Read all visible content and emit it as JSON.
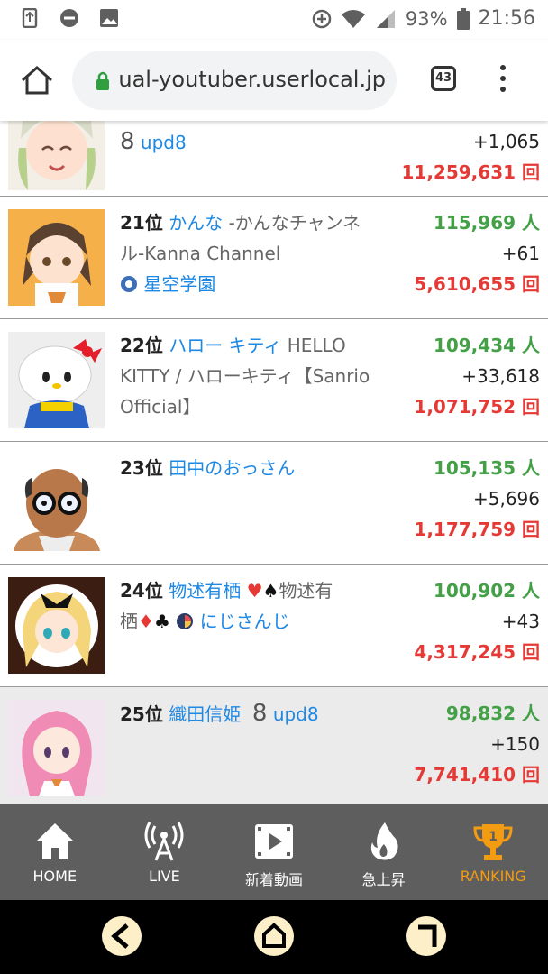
{
  "status": {
    "battery": "93%",
    "time": "21:56"
  },
  "browser": {
    "url": "ual-youtuber.userlocal.jp",
    "tab_count": "43"
  },
  "rows": [
    {
      "rank": "",
      "name": "",
      "subtitle": "",
      "group_prefix": "8",
      "group": "upd8",
      "subscribers": "",
      "delta": "+1,065",
      "views": "11,259,631 回"
    },
    {
      "rank": "21位",
      "name": "かんな",
      "subtitle": "-かんなチャンネル-Kanna Channel",
      "group": "星空学園",
      "subscribers": "115,969 人",
      "delta": "+61",
      "views": "5,610,655 回"
    },
    {
      "rank": "22位",
      "name": "ハロー キティ",
      "subtitle": "HELLO KITTY / ハローキティ【Sanrio Official】",
      "group": "",
      "subscribers": "109,434 人",
      "delta": "+33,618",
      "views": "1,071,752 回"
    },
    {
      "rank": "23位",
      "name": "田中のおっさん",
      "subtitle": "",
      "group": "",
      "subscribers": "105,135 人",
      "delta": "+5,696",
      "views": "1,177,759 回"
    },
    {
      "rank": "24位",
      "name": "物述有栖",
      "subtitle_a": "物述有",
      "subtitle_b": "栖",
      "group": "にじさんじ",
      "subscribers": "100,902 人",
      "delta": "+43",
      "views": "4,317,245 回"
    },
    {
      "rank": "25位",
      "name": "織田信姫",
      "group_prefix": "8",
      "group": "upd8",
      "subscribers": "98,832 人",
      "delta": "+150",
      "views": "7,741,410 回"
    }
  ],
  "nav": [
    {
      "label": "HOME",
      "icon": "home-icon"
    },
    {
      "label": "LIVE",
      "icon": "broadcast-icon"
    },
    {
      "label": "新着動画",
      "icon": "film-icon"
    },
    {
      "label": "急上昇",
      "icon": "flame-icon"
    },
    {
      "label": "RANKING",
      "icon": "trophy-icon",
      "active": true
    }
  ],
  "colors": {
    "accent": "#f39c12",
    "subs": "#43a047",
    "views": "#e53935",
    "link": "#1e88e5"
  }
}
